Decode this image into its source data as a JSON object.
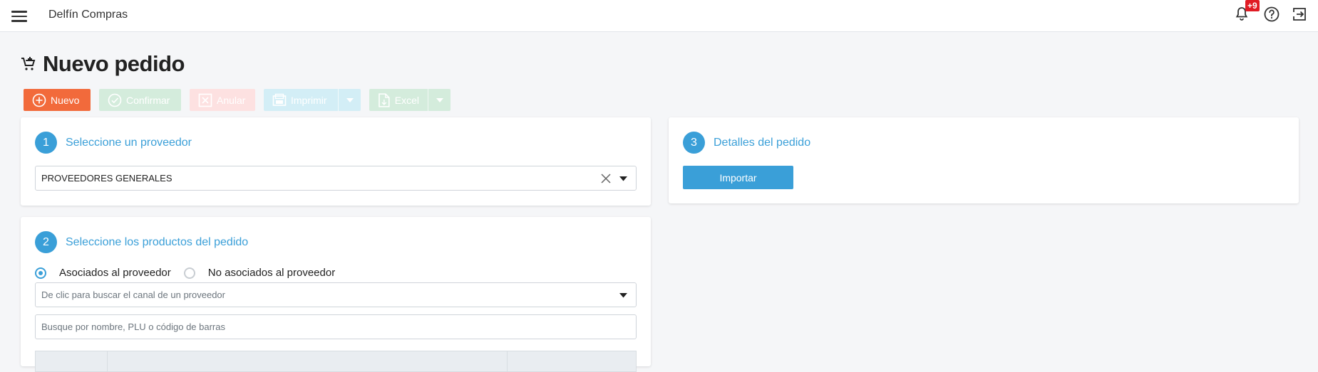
{
  "app": {
    "title": "Delfín Compras"
  },
  "topbar": {
    "notifications_badge": "+9"
  },
  "page": {
    "title": "Nuevo pedido"
  },
  "toolbar": {
    "nuevo": "Nuevo",
    "confirmar": "Confirmar",
    "anular": "Anular",
    "imprimir": "Imprimir",
    "excel": "Excel"
  },
  "step1": {
    "number": "1",
    "title": "Seleccione un proveedor",
    "selected_value": "PROVEEDORES GENERALES"
  },
  "step2": {
    "number": "2",
    "title": "Seleccione los productos del pedido",
    "radio_options": [
      "Asociados al proveedor",
      "No asociados al proveedor"
    ],
    "selected_radio": "Asociados al proveedor",
    "channel_placeholder": "De clic para buscar el canal de un proveedor",
    "search_placeholder": "Busque por nombre, PLU o código de barras"
  },
  "step3": {
    "number": "3",
    "title": "Detalles del pedido",
    "import_label": "Importar"
  },
  "colors": {
    "accent": "#3a9fd8",
    "nuevo_button": "#f26a3b",
    "badge": "#e01b24"
  },
  "icons": [
    "menu-icon",
    "cart-icon",
    "bell-icon",
    "help-icon",
    "logout-icon",
    "plus-circle-icon",
    "check-circle-icon",
    "x-box-icon",
    "print-icon",
    "excel-file-icon",
    "close-icon",
    "chevron-down-icon"
  ]
}
